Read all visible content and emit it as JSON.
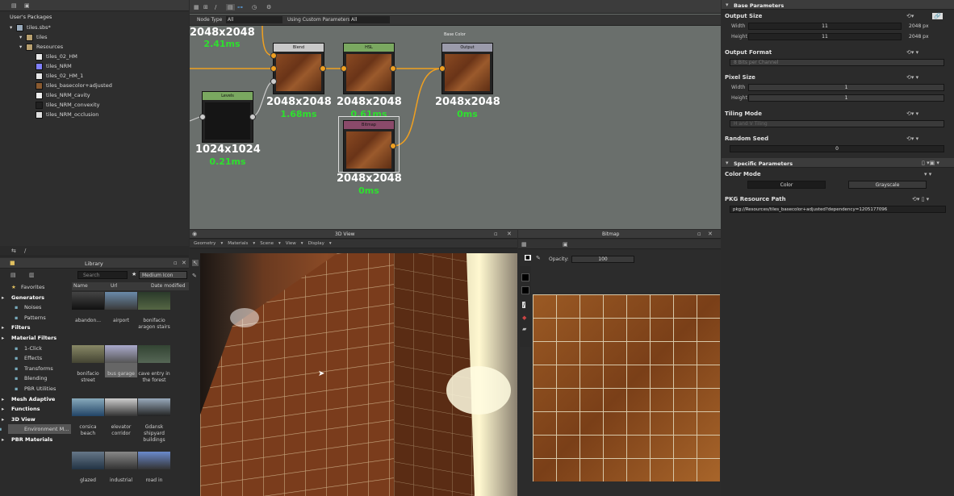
{
  "package_panel": {
    "title": "User's Packages",
    "items": [
      {
        "label": "tiles.sbs*"
      },
      {
        "label": "tiles"
      },
      {
        "label": "Resources"
      },
      {
        "label": "tiles_02_HM",
        "color": "#e8e8e8"
      },
      {
        "label": "tiles_NRM",
        "color": "#8080ff"
      },
      {
        "label": "tiles_02_HM_1",
        "color": "#e8e8e8"
      },
      {
        "label": "tiles_basecolor+adjusted",
        "color": "#8a5a30"
      },
      {
        "label": "tiles_NRM_cavity",
        "color": "#f0f0f0"
      },
      {
        "label": "tiles_NRM_convexity",
        "color": "#202020"
      },
      {
        "label": "tiles_NRM_occlusion",
        "color": "#e0e0e0"
      }
    ]
  },
  "graph_toolbar": {
    "node_type_label": "Node Type",
    "node_type_value": "All",
    "custom_params_label": "Using Custom Parameters",
    "custom_params_value": "All"
  },
  "nodes": [
    {
      "title": "Blend",
      "res": "2048x2048",
      "ms": "1.68ms",
      "color": "#c8c8c8"
    },
    {
      "title": "HSL",
      "res": "2048x2048",
      "ms": "0.61ms",
      "color": "#7aa860"
    },
    {
      "title": "Output",
      "res": "2048x2048",
      "ms": "0ms",
      "color": "#9a9aaa",
      "caption": "Base Color"
    },
    {
      "title": "Levels",
      "res": "1024x1024",
      "ms": "0.21ms",
      "color": "#7aa860"
    },
    {
      "title": "Bitmap",
      "res": "2048x2048",
      "ms": "0ms",
      "color": "#8a4a6a"
    },
    {
      "title": "",
      "res": "2048x2048",
      "ms": "2.41ms"
    }
  ],
  "library": {
    "title": "Library",
    "search_placeholder": "Search",
    "view_mode": "Medium Icon",
    "columns": [
      "Name",
      "Url",
      "Date modified"
    ],
    "categories": [
      {
        "label": "Favorites",
        "bold": false
      },
      {
        "label": "Generators",
        "bold": true
      },
      {
        "label": "Noises",
        "bold": false
      },
      {
        "label": "Patterns",
        "bold": false
      },
      {
        "label": "Filters",
        "bold": true
      },
      {
        "label": "Material Filters",
        "bold": true
      },
      {
        "label": "1-Click",
        "bold": false
      },
      {
        "label": "Effects",
        "bold": false
      },
      {
        "label": "Transforms",
        "bold": false
      },
      {
        "label": "Blending",
        "bold": false
      },
      {
        "label": "PBR Utilities",
        "bold": false
      },
      {
        "label": "Mesh Adaptive",
        "bold": true
      },
      {
        "label": "Functions",
        "bold": true
      },
      {
        "label": "3D View",
        "bold": true
      },
      {
        "label": "Environment M...",
        "bold": false
      },
      {
        "label": "PBR Materials",
        "bold": true
      }
    ],
    "items": [
      {
        "label": "abandon..."
      },
      {
        "label": "airport"
      },
      {
        "label": "bonifacio aragon stairs"
      },
      {
        "label": "bonifacio street"
      },
      {
        "label": "bus garage"
      },
      {
        "label": "cave entry in the forest"
      },
      {
        "label": "corsica beach"
      },
      {
        "label": "elevator corridor"
      },
      {
        "label": "Gdansk shipyard buildings"
      },
      {
        "label": "glazed"
      },
      {
        "label": "industrial"
      },
      {
        "label": "road in"
      }
    ]
  },
  "view3d": {
    "title": "3D View",
    "menu": [
      "Geometry",
      "Materials",
      "Scene",
      "View",
      "Display"
    ]
  },
  "bitmap_view": {
    "title": "Bitmap",
    "opacity_label": "Opacity:",
    "opacity_value": "100"
  },
  "params": {
    "base_title": "Base Parameters",
    "output_size": "Output Size",
    "width_label": "Width",
    "width_value": "11",
    "width_px": "2048 px",
    "height_label": "Height",
    "height_value": "11",
    "height_px": "2048 px",
    "output_format": "Output Format",
    "output_format_value": "8 Bits per Channel",
    "pixel_size": "Pixel Size",
    "px_width_label": "Width",
    "px_width_value": "1",
    "px_height_label": "Height",
    "px_height_value": "1",
    "tiling_mode": "Tiling Mode",
    "tiling_value": "H and V Tiling",
    "random_seed": "Random Seed",
    "random_seed_value": "0",
    "specific_title": "Specific Parameters",
    "color_mode": "Color Mode",
    "color_btn": "Color",
    "grayscale_btn": "Grayscale",
    "pkg_path_label": "PKG Resource Path",
    "pkg_path_value": "pkg://Resources/tiles_basecolor+adjusted?dependency=1205177096"
  }
}
